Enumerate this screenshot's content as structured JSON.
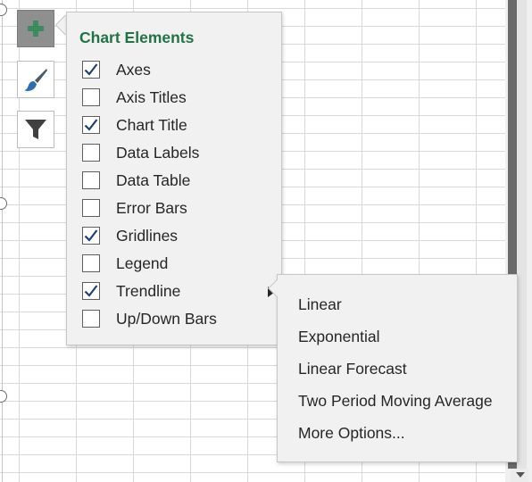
{
  "chart_tools": {
    "elements_button": {
      "icon": "plus-icon"
    },
    "styles_button": {
      "icon": "paintbrush-icon"
    },
    "filters_button": {
      "icon": "funnel-icon"
    }
  },
  "chart_elements": {
    "title": "Chart Elements",
    "items": [
      {
        "label": "Axes",
        "checked": true
      },
      {
        "label": "Axis Titles",
        "checked": false
      },
      {
        "label": "Chart Title",
        "checked": true
      },
      {
        "label": "Data Labels",
        "checked": false
      },
      {
        "label": "Data Table",
        "checked": false
      },
      {
        "label": "Error Bars",
        "checked": false
      },
      {
        "label": "Gridlines",
        "checked": true
      },
      {
        "label": "Legend",
        "checked": false
      },
      {
        "label": "Trendline",
        "checked": true,
        "has_submenu": true
      },
      {
        "label": "Up/Down Bars",
        "checked": false
      }
    ]
  },
  "trendline_submenu": {
    "items": [
      {
        "label": "Linear"
      },
      {
        "label": "Exponential"
      },
      {
        "label": "Linear Forecast"
      },
      {
        "label": "Two Period Moving Average"
      },
      {
        "label": "More Options..."
      }
    ]
  },
  "colors": {
    "accent": "#217346",
    "checkmark": "#1f3f73",
    "panel_bg": "#f1f1f1"
  }
}
